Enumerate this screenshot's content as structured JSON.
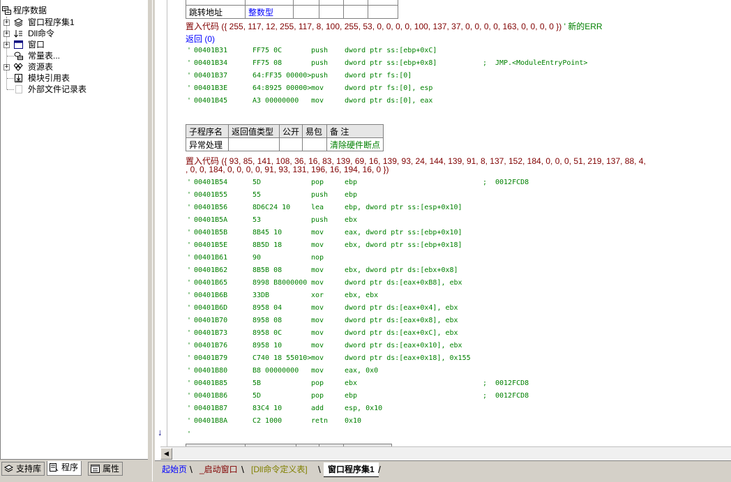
{
  "tree": {
    "root": "程序数据",
    "items": [
      {
        "label": "窗口程序集1",
        "expander": "+",
        "icon": "layers-icon"
      },
      {
        "label": "Dll命令",
        "expander": "+",
        "icon": "dll-sort-icon"
      },
      {
        "label": "窗口",
        "expander": "+",
        "icon": "window-icon"
      },
      {
        "label": "常量表...",
        "expander": "",
        "icon": "constant-table-icon"
      },
      {
        "label": "资源表",
        "expander": "+",
        "icon": "resource-table-icon"
      },
      {
        "label": "模块引用表",
        "expander": "",
        "icon": "module-ref-icon"
      },
      {
        "label": "外部文件记录表",
        "expander": "",
        "icon": "external-file-icon"
      }
    ]
  },
  "left_tabs": [
    {
      "label": "支持库",
      "icon": "support-lib-icon"
    },
    {
      "label": "程序",
      "icon": "program-icon"
    },
    {
      "label": "属性",
      "icon": "property-icon"
    }
  ],
  "code": {
    "top_table": {
      "name": "跳转地址",
      "type": "整数型"
    },
    "ins1": {
      "text": "置入代码 ({ 255, 117, 12, 255, 117, 8, 100, 255, 53, 0, 0, 0, 0, 100, 137, 37, 0, 0, 0, 0, 163, 0, 0, 0, 0 })",
      "comment": " ' 新的ERR"
    },
    "return_line": "返回 (0)",
    "block1": [
      {
        "addr": "00401B31",
        "bytes": "FF75 0C",
        "mn": "push",
        "op": "dword ptr ss:[ebp+0xC]",
        "semi": "",
        "cm": ""
      },
      {
        "addr": "00401B34",
        "bytes": "FF75 08",
        "mn": "push",
        "op": "dword ptr ss:[ebp+0x8]",
        "semi": ";",
        "cm": "JMP.<ModuleEntryPoint>"
      },
      {
        "addr": "00401B37",
        "bytes": "64:FF35 00000>",
        "mn": "push",
        "op": "dword ptr fs:[0]",
        "semi": "",
        "cm": ""
      },
      {
        "addr": "00401B3E",
        "bytes": "64:8925 00000>",
        "mn": "mov",
        "op": "dword ptr fs:[0], esp",
        "semi": "",
        "cm": ""
      },
      {
        "addr": "00401B45",
        "bytes": "A3 00000000",
        "mn": "mov",
        "op": "dword ptr ds:[0], eax",
        "semi": "",
        "cm": ""
      }
    ],
    "sub_table": {
      "headers": [
        "子程序名",
        "返回值类型",
        "公开",
        "易包",
        "备 注"
      ],
      "row": [
        "异常处理",
        "",
        "",
        "",
        "清除硬件断点"
      ]
    },
    "ins2": {
      "line1": "置入代码 ({ 93, 85, 141, 108, 36, 16, 83, 139, 69, 16, 139, 93, 24, 144, 139, 91, 8, 137, 152, 184, 0, 0, 0, 51, 219, 137, 88, 4,",
      "line2": ", 0, 0, 184, 0, 0, 0, 0, 91, 93, 131, 196, 16, 194, 16, 0 })"
    },
    "block2": [
      {
        "addr": "00401B54",
        "bytes": "5D",
        "mn": "pop",
        "op": "ebp",
        "semi": ";",
        "cm": "0012FCD8"
      },
      {
        "addr": "00401B55",
        "bytes": "55",
        "mn": "push",
        "op": "ebp",
        "semi": "",
        "cm": ""
      },
      {
        "addr": "00401B56",
        "bytes": "8D6C24 10",
        "mn": "lea",
        "op": "ebp, dword ptr ss:[esp+0x10]",
        "semi": "",
        "cm": ""
      },
      {
        "addr": "00401B5A",
        "bytes": "53",
        "mn": "push",
        "op": "ebx",
        "semi": "",
        "cm": ""
      },
      {
        "addr": "00401B5B",
        "bytes": "8B45 10",
        "mn": "mov",
        "op": "eax, dword ptr ss:[ebp+0x10]",
        "semi": "",
        "cm": ""
      },
      {
        "addr": "00401B5E",
        "bytes": "8B5D 18",
        "mn": "mov",
        "op": "ebx, dword ptr ss:[ebp+0x18]",
        "semi": "",
        "cm": ""
      },
      {
        "addr": "00401B61",
        "bytes": "90",
        "mn": "nop",
        "op": "",
        "semi": "",
        "cm": ""
      },
      {
        "addr": "00401B62",
        "bytes": "8B5B 08",
        "mn": "mov",
        "op": "ebx, dword ptr ds:[ebx+0x8]",
        "semi": "",
        "cm": ""
      },
      {
        "addr": "00401B65",
        "bytes": "8998 B8000000",
        "mn": "mov",
        "op": "dword ptr ds:[eax+0xB8], ebx",
        "semi": "",
        "cm": ""
      },
      {
        "addr": "00401B6B",
        "bytes": "33DB",
        "mn": "xor",
        "op": "ebx, ebx",
        "semi": "",
        "cm": ""
      },
      {
        "addr": "00401B6D",
        "bytes": "8958 04",
        "mn": "mov",
        "op": "dword ptr ds:[eax+0x4], ebx",
        "semi": "",
        "cm": ""
      },
      {
        "addr": "00401B70",
        "bytes": "8958 08",
        "mn": "mov",
        "op": "dword ptr ds:[eax+0x8], ebx",
        "semi": "",
        "cm": ""
      },
      {
        "addr": "00401B73",
        "bytes": "8958 0C",
        "mn": "mov",
        "op": "dword ptr ds:[eax+0xC], ebx",
        "semi": "",
        "cm": ""
      },
      {
        "addr": "00401B76",
        "bytes": "8958 10",
        "mn": "mov",
        "op": "dword ptr ds:[eax+0x10], ebx",
        "semi": "",
        "cm": ""
      },
      {
        "addr": "00401B79",
        "bytes": "C740 18 55010>",
        "mn": "mov",
        "op": "dword ptr ds:[eax+0x18], 0x155",
        "semi": "",
        "cm": ""
      },
      {
        "addr": "00401B80",
        "bytes": "B8 00000000",
        "mn": "mov",
        "op": "eax, 0x0",
        "semi": "",
        "cm": ""
      },
      {
        "addr": "00401B85",
        "bytes": "5B",
        "mn": "pop",
        "op": "ebx",
        "semi": ";",
        "cm": "0012FCD8"
      },
      {
        "addr": "00401B86",
        "bytes": "5D",
        "mn": "pop",
        "op": "ebp",
        "semi": ";",
        "cm": "0012FCD8"
      },
      {
        "addr": "00401B87",
        "bytes": "83C4 10",
        "mn": "add",
        "op": "esp, 0x10",
        "semi": "",
        "cm": ""
      },
      {
        "addr": "00401B8A",
        "bytes": "C2 1000",
        "mn": "retn",
        "op": "0x10",
        "semi": "",
        "cm": ""
      }
    ],
    "comment_mark": "'"
  },
  "doc_tabs": [
    {
      "label": "起始页",
      "style": "blue"
    },
    {
      "label": "_启动窗口",
      "style": "maroon"
    },
    {
      "label": "[Dll命令定义表]",
      "style": "olive"
    },
    {
      "label": "窗口程序集1",
      "style": "active"
    }
  ],
  "colors": {
    "code_green": "#008000",
    "ins_maroon": "#800000",
    "link_blue": "#0000ff",
    "panel_gray": "#d4d0c8"
  }
}
